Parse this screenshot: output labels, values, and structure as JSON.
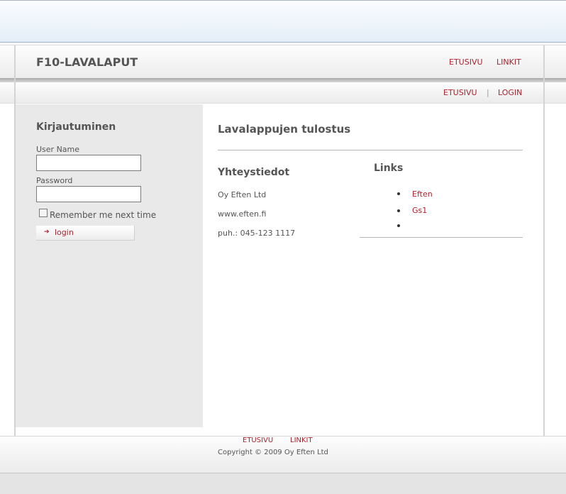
{
  "site": {
    "title": "F10-LAVALAPUT"
  },
  "header_nav": [
    "ETUSIVU",
    "LINKIT"
  ],
  "sub_nav": [
    "ETUSIVU",
    "LOGIN"
  ],
  "sub_nav_separator": "|",
  "login_panel": {
    "title": "Kirjautuminen",
    "username_label": "User Name",
    "username_value": "",
    "password_label": "Password",
    "password_value": "",
    "remember_label": "Remember me next time",
    "remember_checked": false,
    "login_button": "login"
  },
  "main": {
    "title": "Lavalappujen tulostus",
    "contact": {
      "title": "Yhteystiedot",
      "lines": [
        "Oy Eften Ltd",
        "www.eften.fi",
        "puh.: 045-123 1117"
      ]
    },
    "links": {
      "title": "Links",
      "items": [
        "Eften",
        "Gs1",
        ""
      ]
    }
  },
  "footer": {
    "nav": [
      "ETUSIVU",
      "LINKIT"
    ],
    "copyright": "Copyright © 2009 Oy Eften Ltd"
  },
  "colors": {
    "link": "#b0202a",
    "text": "#555555",
    "sidebar_bg": "#e9e9e9"
  }
}
